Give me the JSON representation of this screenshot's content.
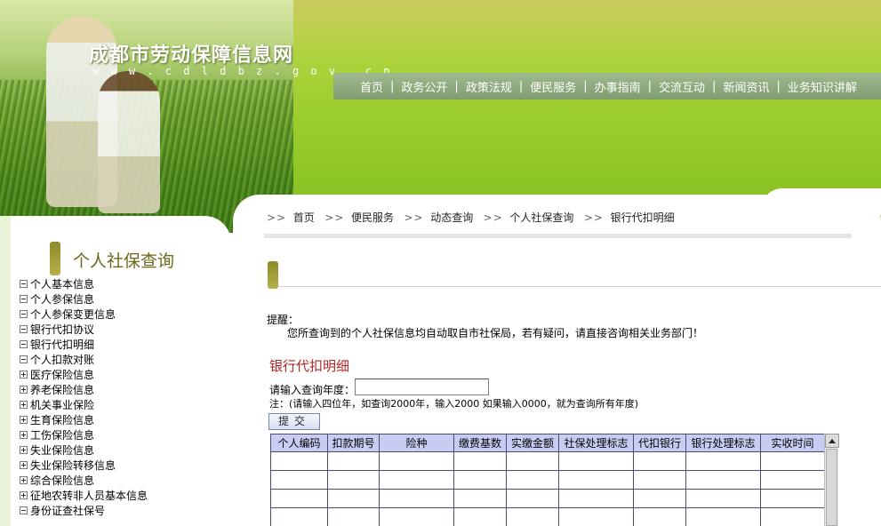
{
  "site": {
    "title": "成都市劳动保障信息网",
    "url": "w w w . c d l d b z . g o v . c n"
  },
  "nav": {
    "items": [
      "首页",
      "政务公开",
      "政策法规",
      "便民服务",
      "办事指南",
      "交流互动",
      "新闻资讯",
      "业务知识讲解"
    ],
    "separator": "|"
  },
  "sidebar": {
    "title": "个人社保查询",
    "items": [
      {
        "label": "个人基本信息",
        "icon": "minus-box-icon"
      },
      {
        "label": "个人参保信息",
        "icon": "minus-box-icon"
      },
      {
        "label": "个人参保变更信息",
        "icon": "minus-box-icon"
      },
      {
        "label": "银行代扣协议",
        "icon": "minus-box-icon"
      },
      {
        "label": "银行代扣明细",
        "icon": "minus-box-icon"
      },
      {
        "label": "个人扣款对账",
        "icon": "minus-box-icon"
      },
      {
        "label": "医疗保险信息",
        "icon": "plus-box-icon"
      },
      {
        "label": "养老保险信息",
        "icon": "plus-box-icon"
      },
      {
        "label": "机关事业保险",
        "icon": "plus-box-icon"
      },
      {
        "label": "生育保险信息",
        "icon": "plus-box-icon"
      },
      {
        "label": "工伤保险信息",
        "icon": "plus-box-icon"
      },
      {
        "label": "失业保险信息",
        "icon": "plus-box-icon"
      },
      {
        "label": "失业保险转移信息",
        "icon": "plus-box-icon"
      },
      {
        "label": "综合保险信息",
        "icon": "plus-box-icon"
      },
      {
        "label": "征地农转非人员基本信息",
        "icon": "plus-box-icon"
      },
      {
        "label": "身份证查社保号",
        "icon": "minus-box-icon"
      }
    ]
  },
  "breadcrumb": {
    "arrow": ">>",
    "items": [
      "首页",
      "便民服务",
      "动态查询",
      "个人社保查询",
      "银行代扣明细"
    ]
  },
  "notice": {
    "label": "提醒：",
    "text": "您所查询到的个人社保信息均自动取自市社保局，若有疑问，请直接咨询相关业务部门！"
  },
  "form": {
    "title": "银行代扣明细",
    "year_label": "请输入查询年度：",
    "year_value": "",
    "note": "注：(请输入四位年，如查询2000年，输入2000  如果输入0000，就为查询所有年度)",
    "submit_label": "提交"
  },
  "table": {
    "columns": [
      "个人编码",
      "扣款期号",
      "险种",
      "缴费基数",
      "实缴金额",
      "社保处理标志",
      "代扣银行",
      "银行处理标志",
      "实收时间"
    ],
    "rows": [
      [
        "",
        "",
        "",
        "",
        "",
        "",
        "",
        "",
        ""
      ],
      [
        "",
        "",
        "",
        "",
        "",
        "",
        "",
        "",
        ""
      ],
      [
        "",
        "",
        "",
        "",
        "",
        "",
        "",
        "",
        ""
      ],
      [
        "",
        "",
        "",
        "",
        "",
        "",
        "",
        "",
        ""
      ]
    ]
  },
  "colors": {
    "nav_bg": "#8eaa80",
    "header_bg": "#a9d23a",
    "table_header_bg": "#c9ccf2",
    "detail_title": "#b22222",
    "sidebar_title": "#6b6a1a"
  }
}
